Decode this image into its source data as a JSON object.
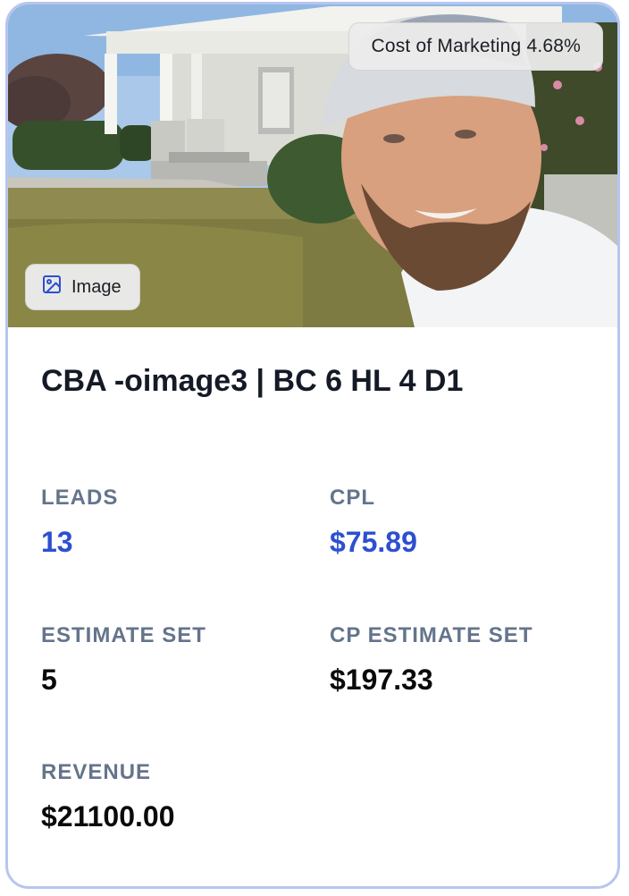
{
  "card": {
    "cost_badge": "Cost of Marketing 4.68%",
    "media_type_label": "Image",
    "media_type_icon": "image-icon",
    "title": "CBA -oimage3 | BC 6 HL 4 D1",
    "metrics": {
      "leads": {
        "label": "LEADS",
        "value": "13"
      },
      "cpl": {
        "label": "CPL",
        "value": "$75.89"
      },
      "estimate_set": {
        "label": "ESTIMATE SET",
        "value": "5"
      },
      "cp_estimate_set": {
        "label": "CP ESTIMATE SET",
        "value": "$197.33"
      },
      "revenue": {
        "label": "REVENUE",
        "value": "$21100.00"
      }
    }
  },
  "colors": {
    "card_border": "#b8c5ef",
    "accent_value": "#2d4fd1",
    "label": "#64748b",
    "title": "#141a26"
  }
}
